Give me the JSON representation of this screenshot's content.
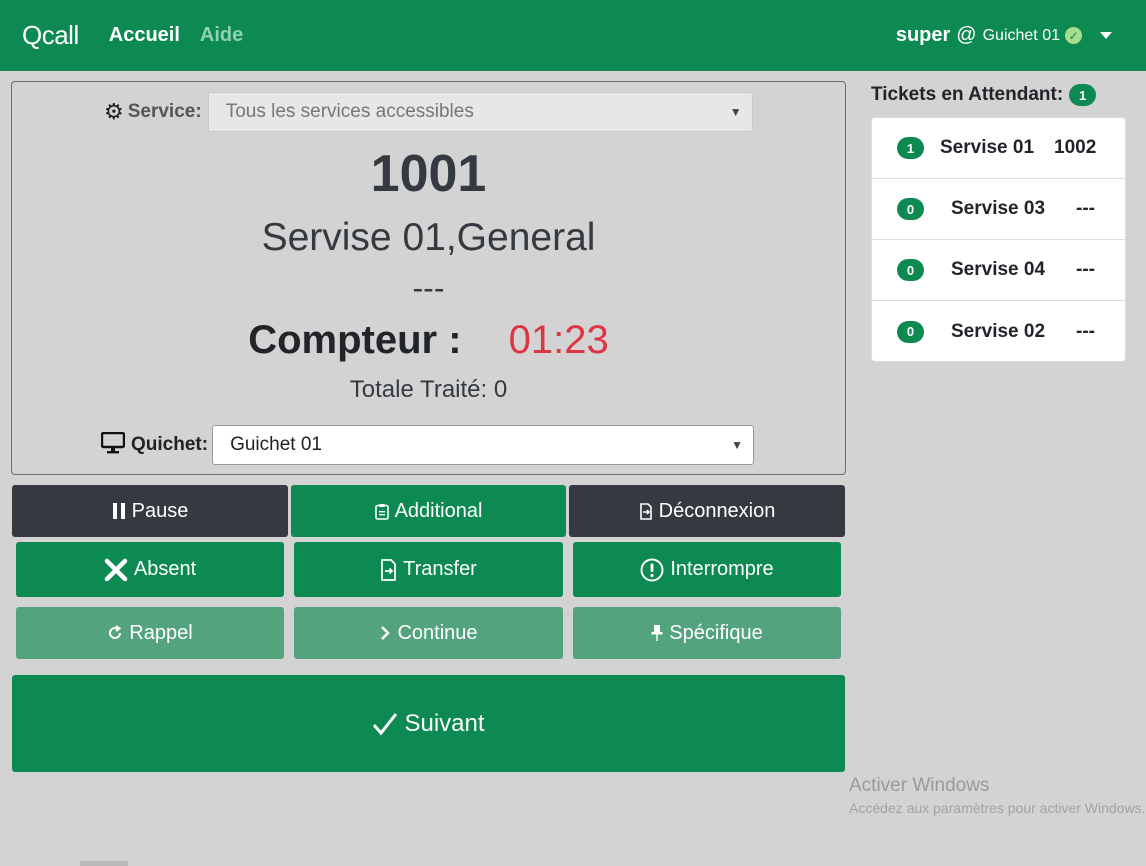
{
  "navbar": {
    "brand": "Qcall",
    "links": [
      {
        "label": "Accueil"
      },
      {
        "label": "Aide"
      }
    ],
    "user": {
      "name": "super",
      "at": "@",
      "guichet": "Guichet 01"
    }
  },
  "panel": {
    "service_label": "Service:",
    "service_select": "Tous les services accessibles",
    "ticket_number": "1001",
    "ticket_service": "Servise 01,General",
    "ticket_extra": "---",
    "counter_label": "Compteur :",
    "counter_value": "01:23",
    "totale": "Totale Traité: 0",
    "quichet_label": "Quichet:",
    "quichet_select": "Guichet 01"
  },
  "buttons": {
    "pause": "Pause",
    "additional": "Additional",
    "deconnexion": "Déconnexion",
    "absent": "Absent",
    "transfer": "Transfer",
    "interrompre": "Interrompre",
    "rappel": "Rappel",
    "continue": "Continue",
    "specifique": "Spécifique",
    "suivant": "Suivant"
  },
  "waiting": {
    "title": "Tickets en Attendant:",
    "count": "1",
    "items": [
      {
        "count": "1",
        "name": "Servise 01",
        "ticket": "1002"
      },
      {
        "count": "0",
        "name": "Servise 03",
        "ticket": "---"
      },
      {
        "count": "0",
        "name": "Servise 04",
        "ticket": "---"
      },
      {
        "count": "0",
        "name": "Servise 02",
        "ticket": "---"
      }
    ]
  },
  "watermark": {
    "title": "Activer Windows",
    "subtitle": "Accédez aux paramètres pour activer Windows."
  },
  "colors": {
    "primary": "#0d8a52",
    "dark": "#343a40",
    "light_green": "#52a37e",
    "danger": "#dc3545"
  }
}
